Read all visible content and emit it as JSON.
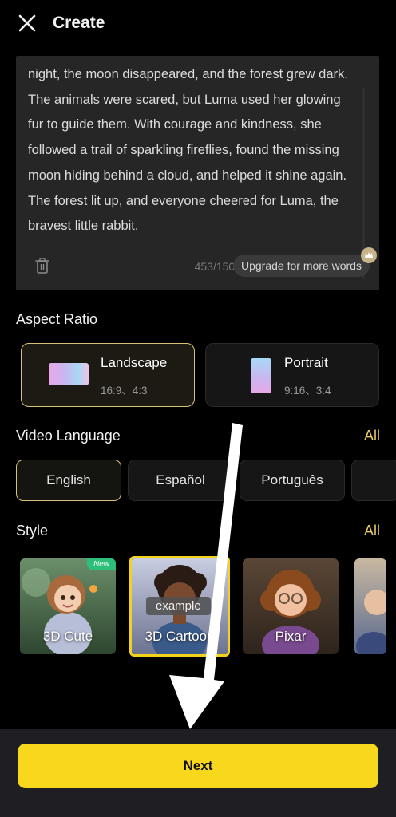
{
  "header": {
    "title": "Create",
    "close_icon": "close-icon"
  },
  "story": {
    "lines": [
      "night, the moon disappeared, and the forest grew dark.",
      "The animals were scared, but Luma used her glowing",
      "fur to guide them. With courage and kindness, she",
      "followed a trail of sparkling fireflies, found the missing",
      "moon hiding behind a cloud, and helped it shine again.",
      "The forest lit up, and everyone cheered for Luma, the",
      "bravest little rabbit."
    ],
    "word_count": "453/1500",
    "upgrade_label": "Upgrade for more words"
  },
  "aspect_ratio": {
    "title": "Aspect Ratio",
    "options": [
      {
        "label": "Landscape",
        "sub": "16:9、4:3",
        "selected": true
      },
      {
        "label": "Portrait",
        "sub": "9:16、3:4",
        "selected": false
      }
    ]
  },
  "video_language": {
    "title": "Video Language",
    "all_label": "All",
    "options": [
      {
        "label": "English",
        "selected": true
      },
      {
        "label": "Español",
        "selected": false
      },
      {
        "label": "Português",
        "selected": false
      }
    ]
  },
  "style": {
    "title": "Style",
    "all_label": "All",
    "items": [
      {
        "label": "3D Cute",
        "badge": "New",
        "selected": false
      },
      {
        "label": "3D Cartoon",
        "tag": "example",
        "selected": true
      },
      {
        "label": "Pixar",
        "selected": false
      }
    ]
  },
  "footer": {
    "next_label": "Next"
  },
  "colors": {
    "accent_yellow": "#f8d81c",
    "accent_gold": "#d8c27a",
    "background": "#000000"
  }
}
